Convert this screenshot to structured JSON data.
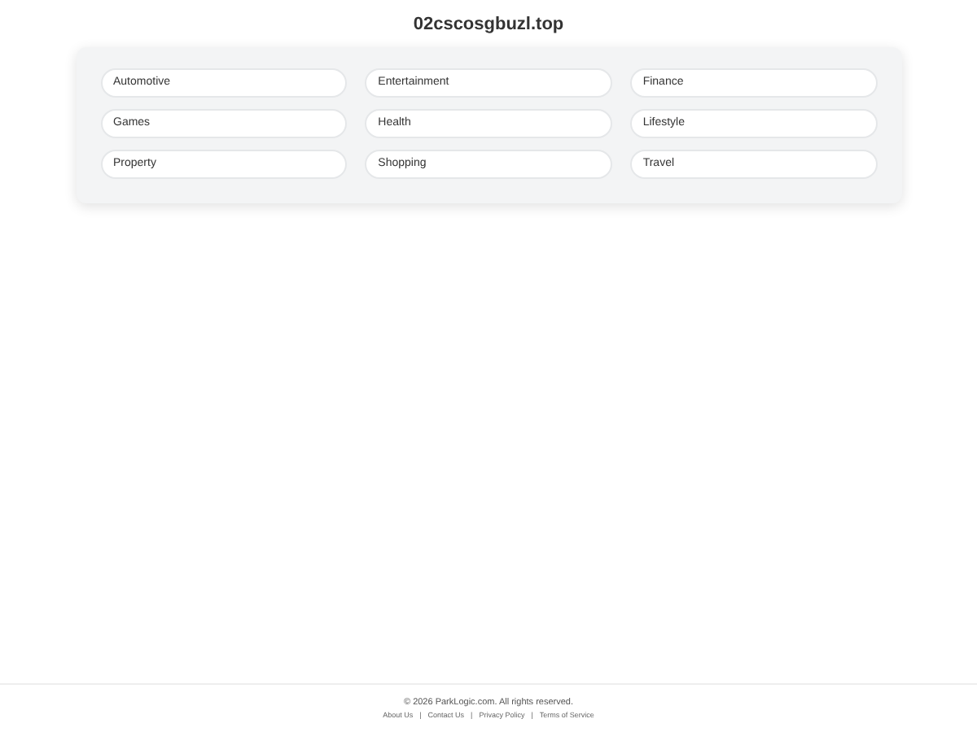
{
  "title": "02cscosgbuzl.top",
  "categories": [
    {
      "label": "Automotive"
    },
    {
      "label": "Entertainment"
    },
    {
      "label": "Finance"
    },
    {
      "label": "Games"
    },
    {
      "label": "Health"
    },
    {
      "label": "Lifestyle"
    },
    {
      "label": "Property"
    },
    {
      "label": "Shopping"
    },
    {
      "label": "Travel"
    }
  ],
  "footer": {
    "copyright": "© 2026 ParkLogic.com. All rights reserved.",
    "separator": "|",
    "links": [
      "About Us",
      "Contact Us",
      "Privacy Policy",
      "Terms of Service"
    ]
  }
}
